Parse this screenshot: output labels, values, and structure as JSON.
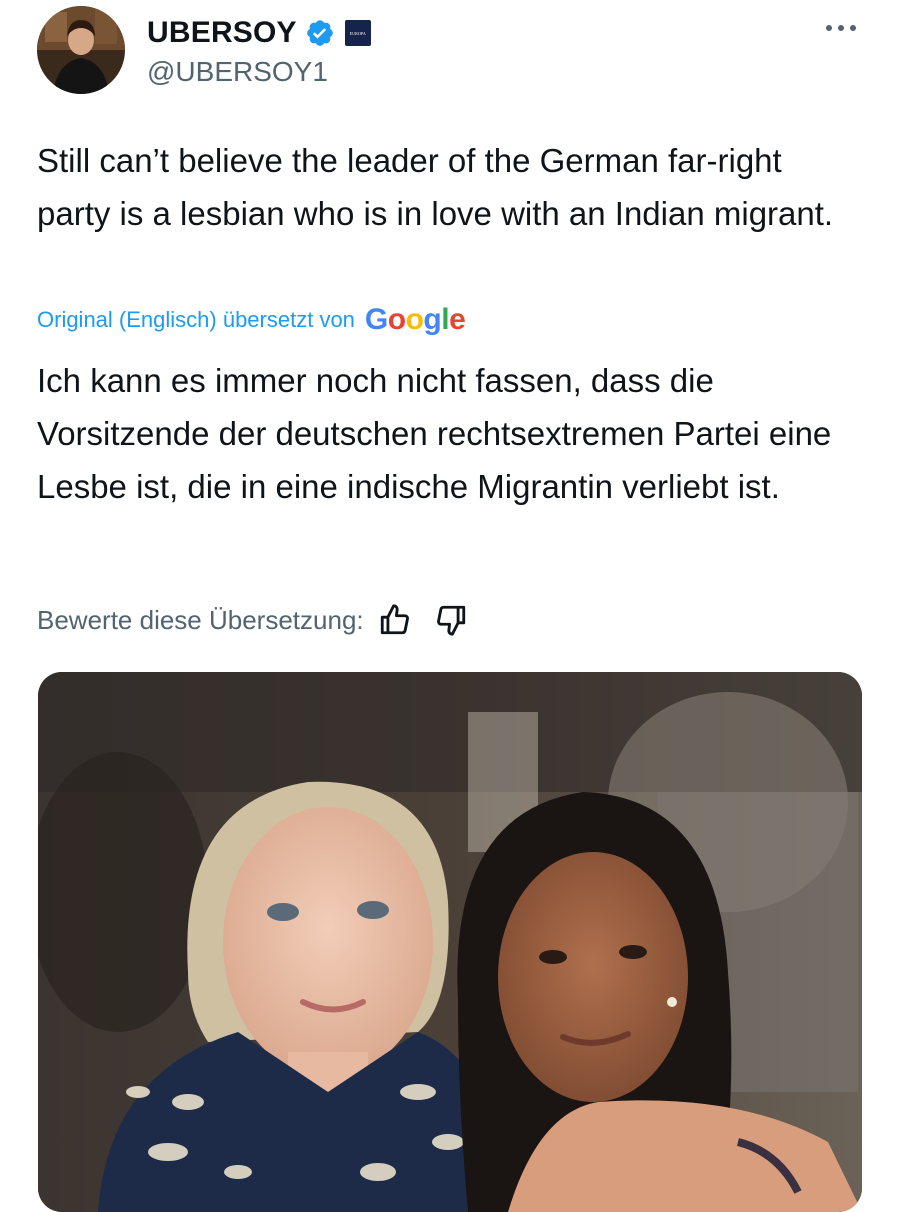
{
  "user": {
    "display_name": "UBERSOY",
    "handle": "@UBERSOY1",
    "verified": true,
    "affiliate_badge_text": "EUROPA"
  },
  "tweet": {
    "text": "Still can’t believe the leader of the German far-right party is a lesbian who is in love with an Indian migrant.",
    "translation_notice": "Original (Englisch) übersetzt von",
    "translation_provider": "Google",
    "translated_text": "Ich kann es immer noch nicht fassen, dass die Vorsitzende der deutschen rechtsextremen Partei eine Lesbe ist, die in eine indische Migrantin verliebt ist.",
    "rate_label": "Bewerte diese Übersetzung:"
  },
  "icons": {
    "verified": "verified-badge-icon",
    "more": "more-icon",
    "thumbs_up": "thumbs-up-icon",
    "thumbs_down": "thumbs-down-icon"
  },
  "colors": {
    "link": "#1d9bf0",
    "secondary_text": "#536471",
    "primary_text": "#0f1419",
    "verified": "#1d9bf0"
  }
}
